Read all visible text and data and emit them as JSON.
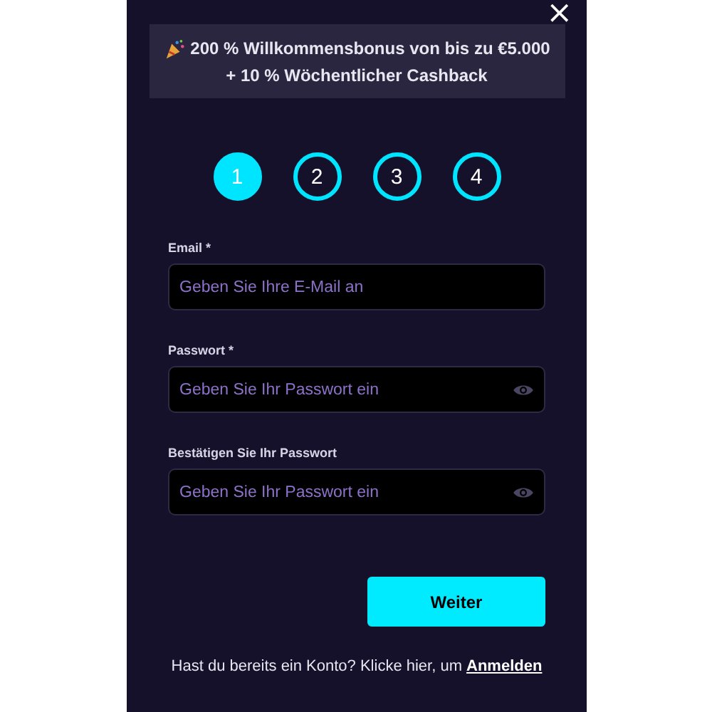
{
  "close_button": "×",
  "banner": {
    "lines": [
      "200 % Willkommensbonus von bis zu €5.000",
      "+ 10 % Wöchentlicher Cashback"
    ]
  },
  "steps": [
    {
      "label": "1",
      "selected": true
    },
    {
      "label": "2",
      "selected": false
    },
    {
      "label": "3",
      "selected": false
    },
    {
      "label": "4",
      "selected": false
    }
  ],
  "fields": [
    {
      "label": "Email *",
      "placeholder": "Geben Sie Ihre E-Mail an",
      "kind": "email"
    },
    {
      "label": "Passwort *",
      "placeholder": "Geben Sie Ihr Passwort ein",
      "kind": "password"
    },
    {
      "label": "Bestätigen Sie Ihr Passwort",
      "placeholder": "Geben Sie Ihr Passwort ein",
      "kind": "password"
    }
  ],
  "submit_button": "Weiter",
  "footer": {
    "text": "Hast du bereits ein Konto? Klicke hier, um",
    "link": "Anmelden"
  }
}
